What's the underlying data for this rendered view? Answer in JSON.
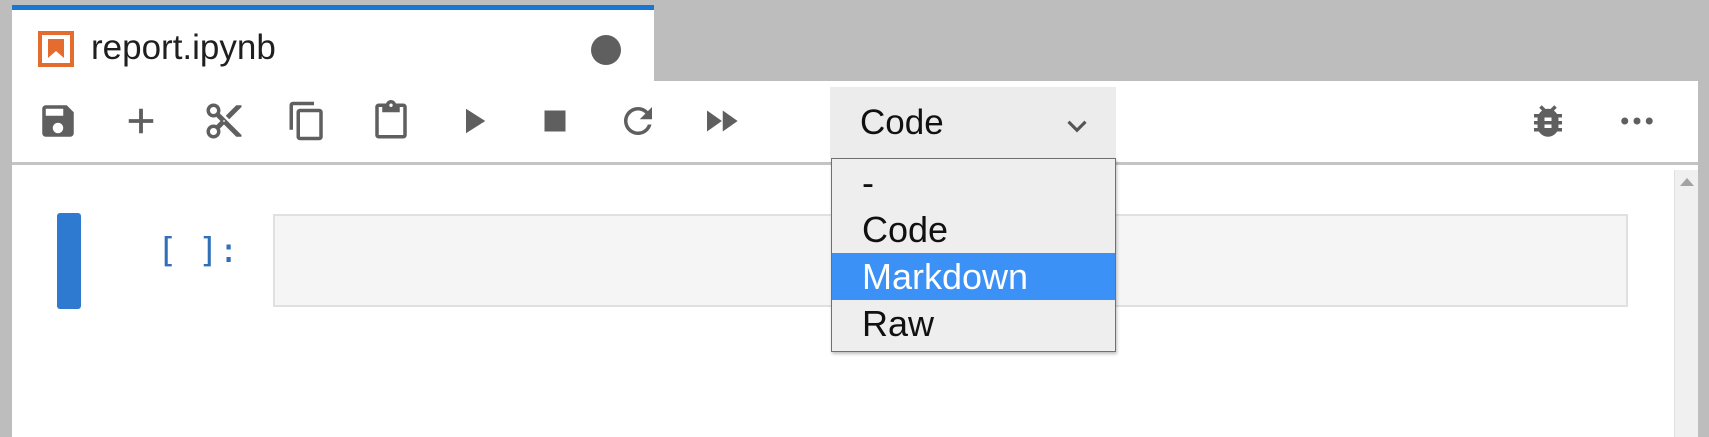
{
  "tab": {
    "title": "report.ipynb",
    "icon": "notebook-icon",
    "unsaved_indicator": "circle-icon"
  },
  "toolbar": {
    "buttons": [
      {
        "name": "save",
        "icon": "save-icon"
      },
      {
        "name": "insert-cell",
        "icon": "plus-icon"
      },
      {
        "name": "cut",
        "icon": "scissors-icon"
      },
      {
        "name": "copy",
        "icon": "copy-icon"
      },
      {
        "name": "paste",
        "icon": "clipboard-icon"
      },
      {
        "name": "run",
        "icon": "play-icon"
      },
      {
        "name": "interrupt",
        "icon": "stop-icon"
      },
      {
        "name": "restart",
        "icon": "refresh-icon"
      },
      {
        "name": "run-all",
        "icon": "fast-forward-icon"
      },
      {
        "name": "debugger",
        "icon": "bug-icon"
      },
      {
        "name": "more",
        "icon": "ellipsis-icon"
      }
    ],
    "cell_type": {
      "value": "Code",
      "options": [
        "-",
        "Code",
        "Markdown",
        "Raw"
      ],
      "highlighted": "Markdown"
    }
  },
  "cell": {
    "prompt": "[ ]:",
    "source": ""
  },
  "colors": {
    "accent": "#1976d2",
    "selection": "#3b91f5",
    "prompt": "#3070b8",
    "icon": "#5f5f5f",
    "notebook_icon": "#e46c2e"
  }
}
